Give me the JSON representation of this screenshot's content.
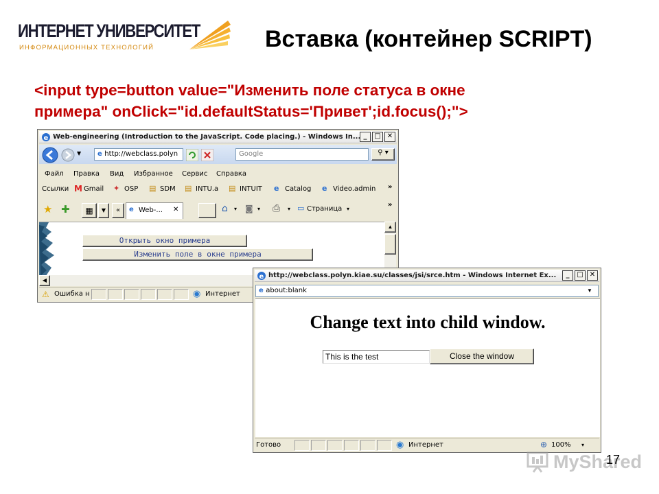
{
  "slide": {
    "logo_title": "ИНТЕРНЕТ УНИВЕРСИТЕТ",
    "logo_subtitle": "ИНФОРМАЦИОННЫХ ТЕХНОЛОГИЙ",
    "title": "Вставка (контейнер SCRIPT)",
    "code_line_1": "<input type=button value=\"Изменить поле статуса в окне",
    "code_line_2": "примера\" onClick=\"id.defaultStatus='Привет';id.focus();\">",
    "page_number": "17",
    "watermark": "MyShared"
  },
  "main_window": {
    "title": "Web-engineering (Introduction to the JavaScript. Code placing.) - Windows In...",
    "address": "http://webclass.polyn",
    "search_placeholder": "Google",
    "menu": [
      "Файл",
      "Правка",
      "Вид",
      "Избранное",
      "Сервис",
      "Справка"
    ],
    "links_label": "Ссылки",
    "links": [
      "Gmail",
      "OSP",
      "SDM",
      "INTU.a",
      "INTUIT",
      "Catalog",
      "Video.admin"
    ],
    "tab_label": "Web-...",
    "page_menu": "Страница",
    "button_open": "Открыть окно примера",
    "button_change": "Изменить поле в окне примера",
    "status_text": "Ошибка н",
    "zone_text": "Интернет"
  },
  "child_window": {
    "title": "http://webclass.polyn.kiae.su/classes/jsi/srce.htm - Windows Internet Ex...",
    "address": "about:blank",
    "heading": "Change text into child window.",
    "input_value": "This is the test",
    "close_button": "Close the window",
    "status_text": "Готово",
    "zone_text": "Интернет",
    "zoom": "100%"
  },
  "colors": {
    "code_red": "#c00000",
    "logo_orange": "#d4880e",
    "window_face": "#ece9d8"
  }
}
